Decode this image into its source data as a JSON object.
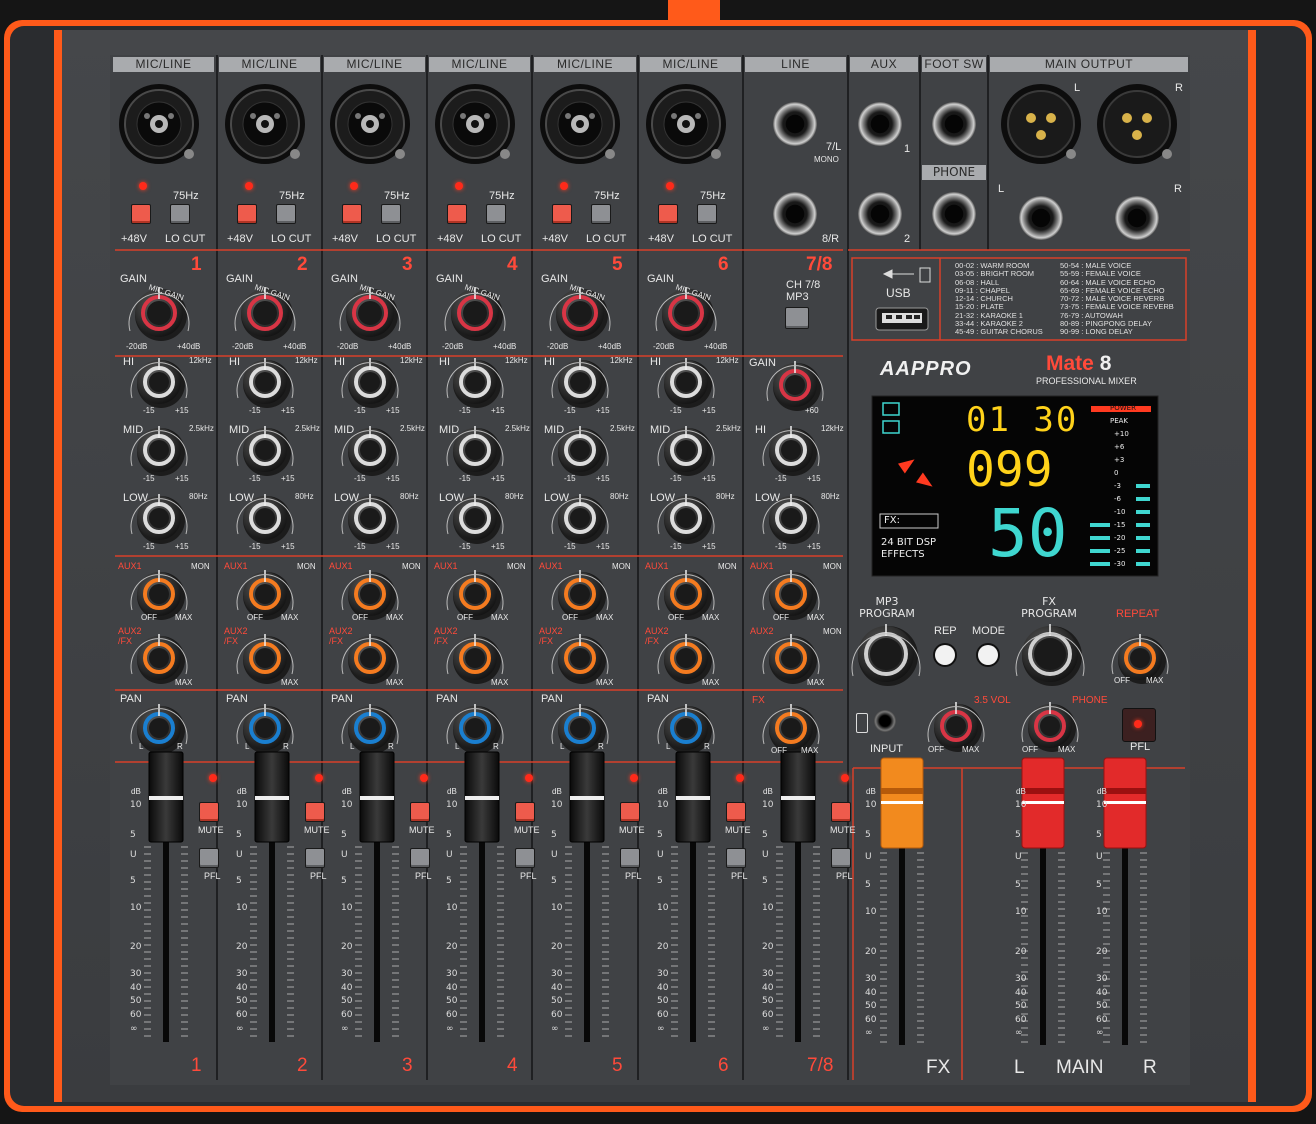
{
  "headers": {
    "channels": [
      "MIC/LINE",
      "MIC/LINE",
      "MIC/LINE",
      "MIC/LINE",
      "MIC/LINE",
      "MIC/LINE"
    ],
    "line": "LINE",
    "aux": "AUX",
    "foot_sw": "FOOT SW",
    "main_output": "MAIN OUTPUT"
  },
  "channel_numbers": [
    "1",
    "2",
    "3",
    "4",
    "5",
    "6"
  ],
  "stereo_channel_number": "7/8",
  "labels": {
    "phantom": "+48V",
    "hz": "75Hz",
    "lo_cut": "LO CUT",
    "gain": "GAIN",
    "mic_gain": "MIC GAIN",
    "u": "U",
    "gain_min": "-20dB",
    "gain_max": "+40dB",
    "gain_plus": "+60",
    "hi": "HI",
    "mid": "MID",
    "low": "LOW",
    "hi_freq": "12kHz",
    "mid_freq": "2.5kHz",
    "low_freq": "80Hz",
    "eq_min": "-15",
    "eq_max": "+15",
    "aux1": "AUX1",
    "mon": "MON",
    "aux2": "AUX2",
    "fx_slash": "/FX",
    "off": "OFF",
    "max": "MAX",
    "pan": "PAN",
    "l": "L",
    "r": "R",
    "mute": "MUTE",
    "pfl": "PFL",
    "db": "dB",
    "fx": "FX",
    "line_7l": "7/L",
    "line_mono": "MONO",
    "line_8r": "8/R",
    "ch78": "CH 7/8",
    "mp3": "MP3",
    "aux_1": "1",
    "aux_2": "2",
    "phone": "PHONE",
    "usb": "USB",
    "mic_gain_st_max": "+60"
  },
  "fader_scale": [
    "10",
    "5",
    "U",
    "5",
    "10",
    "20",
    "30",
    "40",
    "50",
    "60",
    "∞"
  ],
  "fx_presets_left": [
    "00-02 : WARM ROOM",
    "03-05 : BRIGHT ROOM",
    "06-08 : HALL",
    "09-11 : CHAPEL",
    "12-14 : CHURCH",
    "15-20 : PLATE",
    "21-32 : KARAOKE 1",
    "33-44 : KARAOKE 2",
    "45-49 : GUITAR CHORUS"
  ],
  "fx_presets_right": [
    "50-54 : MALE VOICE",
    "55-59 : FEMALE VOICE",
    "60-64 : MALE VOICE ECHO",
    "65-69 : FEMALE VOICE ECHO",
    "70-72 : MALE VOICE REVERB",
    "73-75 : FEMALE VOICE REVERB",
    "76-79 : AUTOWAH",
    "80-89 : PINGPONG DELAY",
    "90-99 : LONG DELAY"
  ],
  "brand": {
    "logo": "AAPPRO",
    "model": "Mate",
    "model_num": "8",
    "subtitle": "PROFESSIONAL MIXER"
  },
  "display": {
    "time": "01 30",
    "track": "099",
    "fx_label": "FX:",
    "fx_value": "50",
    "dsp1": "24 BIT DSP",
    "dsp2": "EFFECTS",
    "meter_labels": [
      "POWER",
      "PEAK",
      "+10",
      "+6",
      "+3",
      "0",
      "-3",
      "-6",
      "-10",
      "-15",
      "-20",
      "-25",
      "-30"
    ]
  },
  "controls": {
    "mp3_program": "MP3\nPROGRAM",
    "rep": "REP",
    "mode": "MODE",
    "fx_program": "FX\nPROGRAM",
    "repeat": "REPEAT",
    "input": "INPUT",
    "vol35": "3.5 VOL",
    "phone": "PHONE",
    "pfl": "PFL"
  },
  "bottom": {
    "fx": "FX",
    "l": "L",
    "main": "MAIN",
    "r": "R"
  },
  "colors": {
    "panel": "#3f4144",
    "accent_orange": "#ff5a1a",
    "red_text": "#ff4a3a",
    "knob_orange": "#f47b20",
    "knob_blue": "#1a7fd0",
    "knob_red": "#d83545",
    "lcd_yellow": "#ffd21a",
    "lcd_cyan": "#3fd7d0"
  }
}
